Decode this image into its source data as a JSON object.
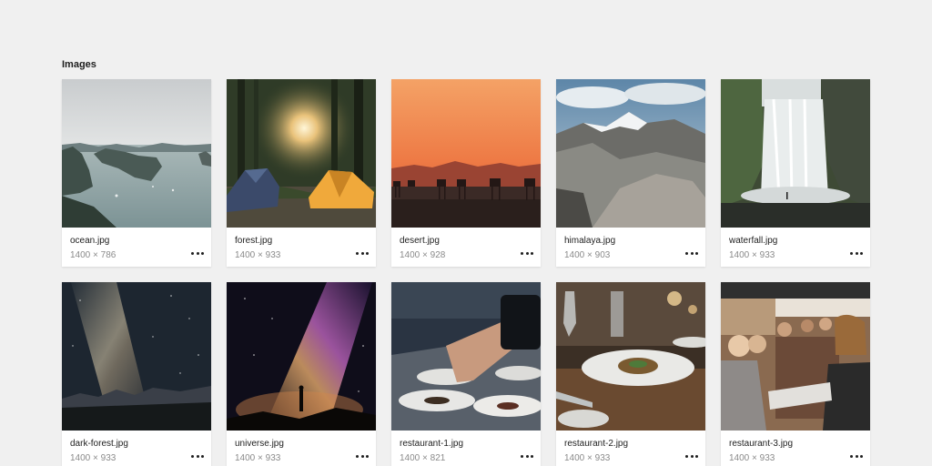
{
  "section": {
    "title": "Images"
  },
  "images": [
    {
      "name": "ocean.jpg",
      "dims": "1400 × 786",
      "icon": "more-horizontal-icon"
    },
    {
      "name": "forest.jpg",
      "dims": "1400 × 933",
      "icon": "more-horizontal-icon"
    },
    {
      "name": "desert.jpg",
      "dims": "1400 × 928",
      "icon": "more-horizontal-icon"
    },
    {
      "name": "himalaya.jpg",
      "dims": "1400 × 903",
      "icon": "more-horizontal-icon"
    },
    {
      "name": "waterfall.jpg",
      "dims": "1400 × 933",
      "icon": "more-horizontal-icon"
    },
    {
      "name": "dark-forest.jpg",
      "dims": "1400 × 933",
      "icon": "more-horizontal-icon"
    },
    {
      "name": "universe.jpg",
      "dims": "1400 × 933",
      "icon": "more-horizontal-icon"
    },
    {
      "name": "restaurant-1.jpg",
      "dims": "1400 × 821",
      "icon": "more-horizontal-icon"
    },
    {
      "name": "restaurant-2.jpg",
      "dims": "1400 × 933",
      "icon": "more-horizontal-icon"
    },
    {
      "name": "restaurant-3.jpg",
      "dims": "1400 × 933",
      "icon": "more-horizontal-icon"
    }
  ],
  "colors": {
    "background": "#f0f0f0",
    "card": "#ffffff",
    "text": "#1e1e1e",
    "muted": "#8a8a8a"
  }
}
